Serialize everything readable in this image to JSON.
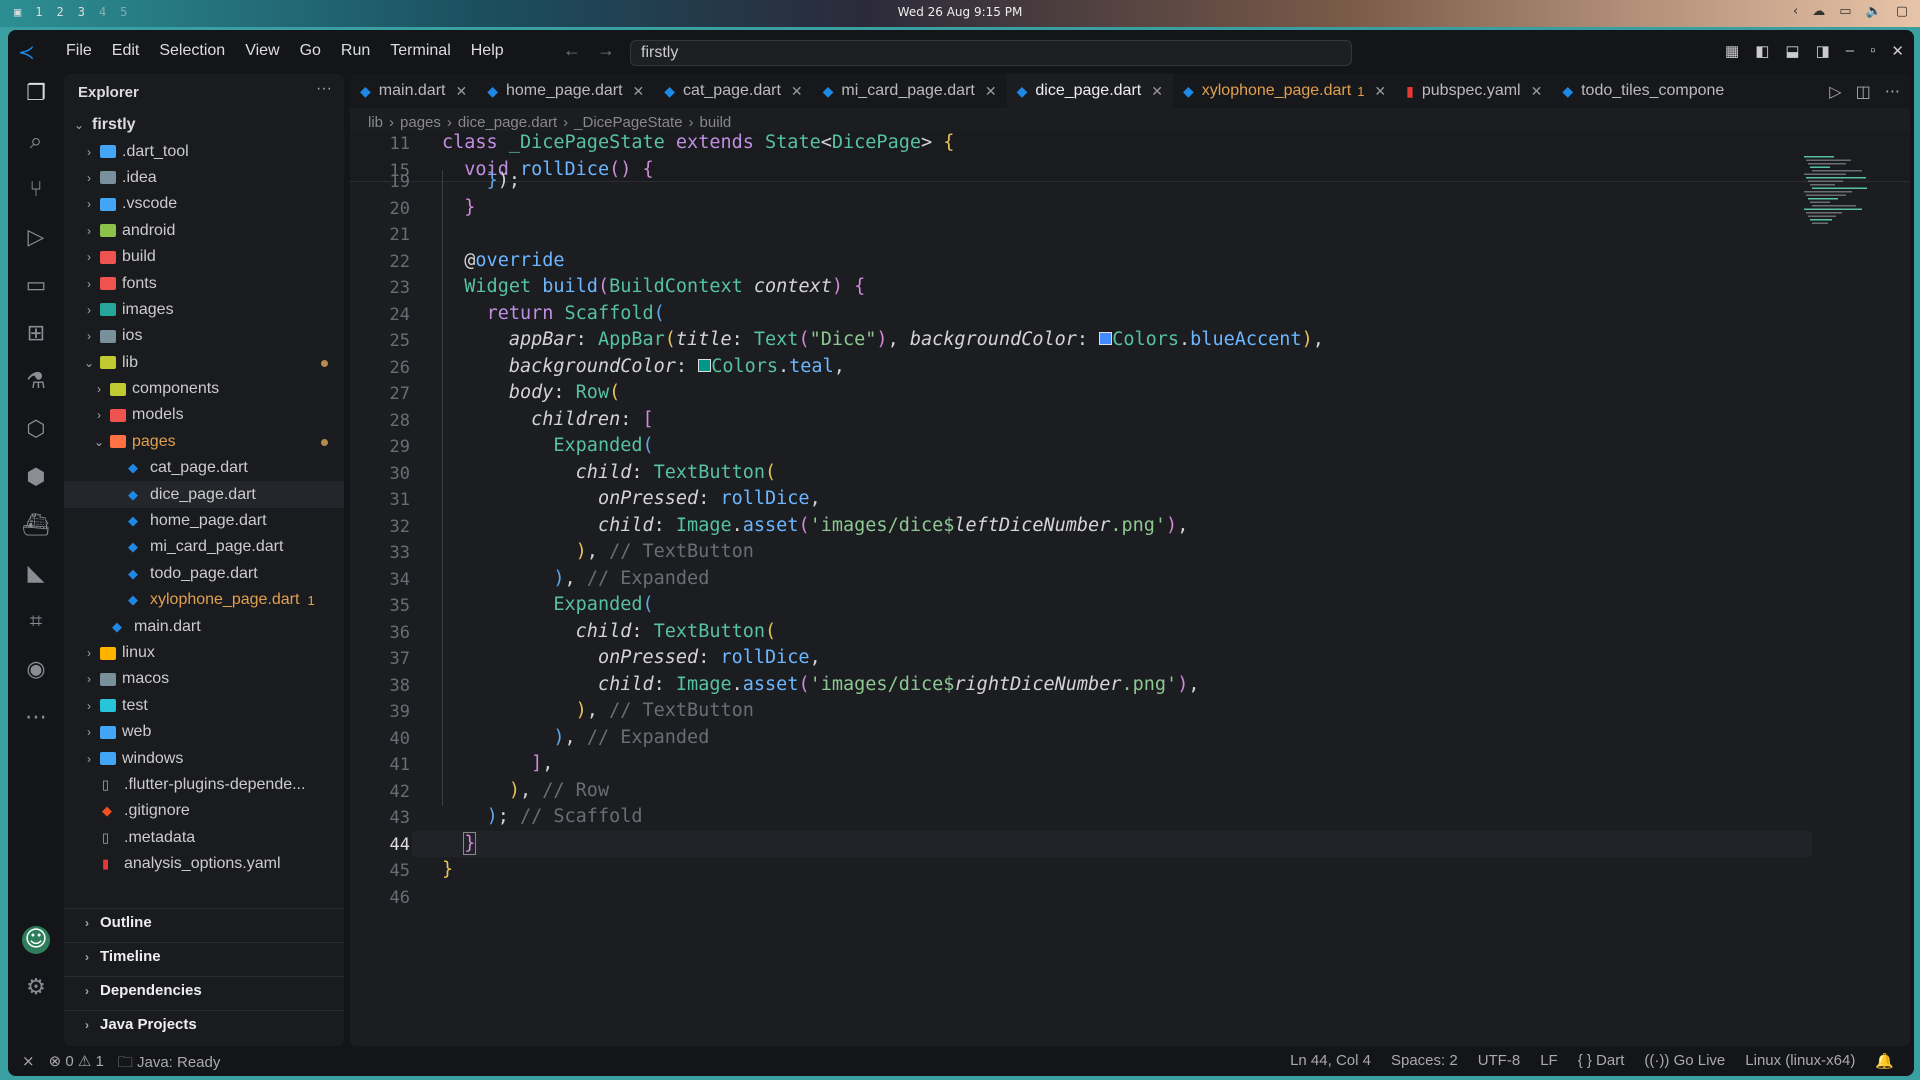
{
  "system_bar": {
    "workspaces": [
      "1",
      "2",
      "3",
      "4",
      "5"
    ],
    "clock": "Wed 26 Aug 9:15 PM"
  },
  "titlebar": {
    "menu": [
      "File",
      "Edit",
      "Selection",
      "View",
      "Go",
      "Run",
      "Terminal",
      "Help"
    ],
    "search_value": "firstly"
  },
  "sidebar": {
    "title": "Explorer",
    "root": "firstly",
    "tree": [
      {
        "label": ".dart_tool",
        "depth": 1,
        "type": "folder",
        "color": "#42a5f5"
      },
      {
        "label": ".idea",
        "depth": 1,
        "type": "folder",
        "color": "#78909c"
      },
      {
        "label": ".vscode",
        "depth": 1,
        "type": "folder",
        "color": "#42a5f5"
      },
      {
        "label": "android",
        "depth": 1,
        "type": "folder",
        "color": "#8bc34a"
      },
      {
        "label": "build",
        "depth": 1,
        "type": "folder",
        "color": "#ef5350"
      },
      {
        "label": "fonts",
        "depth": 1,
        "type": "folder",
        "color": "#ef5350"
      },
      {
        "label": "images",
        "depth": 1,
        "type": "folder",
        "color": "#26a69a"
      },
      {
        "label": "ios",
        "depth": 1,
        "type": "folder",
        "color": "#78909c"
      },
      {
        "label": "lib",
        "depth": 1,
        "type": "folder-open",
        "color": "#c0ca33",
        "modified": true
      },
      {
        "label": "components",
        "depth": 2,
        "type": "folder",
        "color": "#c0ca33"
      },
      {
        "label": "models",
        "depth": 2,
        "type": "folder",
        "color": "#ef5350"
      },
      {
        "label": "pages",
        "depth": 2,
        "type": "folder-open",
        "color": "#ff7043",
        "modified": true,
        "orange": true
      },
      {
        "label": "cat_page.dart",
        "depth": 3,
        "type": "dart"
      },
      {
        "label": "dice_page.dart",
        "depth": 3,
        "type": "dart",
        "selected": true
      },
      {
        "label": "home_page.dart",
        "depth": 3,
        "type": "dart"
      },
      {
        "label": "mi_card_page.dart",
        "depth": 3,
        "type": "dart"
      },
      {
        "label": "todo_page.dart",
        "depth": 3,
        "type": "dart"
      },
      {
        "label": "xylophone_page.dart",
        "depth": 3,
        "type": "dart",
        "orange": true,
        "badge": "1"
      },
      {
        "label": "main.dart",
        "depth": 2,
        "type": "dart"
      },
      {
        "label": "linux",
        "depth": 1,
        "type": "folder",
        "color": "#ffb300"
      },
      {
        "label": "macos",
        "depth": 1,
        "type": "folder",
        "color": "#78909c"
      },
      {
        "label": "test",
        "depth": 1,
        "type": "folder",
        "color": "#26c6da"
      },
      {
        "label": "web",
        "depth": 1,
        "type": "folder",
        "color": "#42a5f5"
      },
      {
        "label": "windows",
        "depth": 1,
        "type": "folder",
        "color": "#42a5f5"
      },
      {
        "label": ".flutter-plugins-depende...",
        "depth": 1,
        "type": "file"
      },
      {
        "label": ".gitignore",
        "depth": 1,
        "type": "git"
      },
      {
        "label": ".metadata",
        "depth": 1,
        "type": "file"
      },
      {
        "label": "analysis_options.yaml",
        "depth": 1,
        "type": "yaml"
      }
    ],
    "sections": [
      "Outline",
      "Timeline",
      "Dependencies",
      "Java Projects"
    ]
  },
  "tabs": [
    {
      "label": "main.dart"
    },
    {
      "label": "home_page.dart"
    },
    {
      "label": "cat_page.dart"
    },
    {
      "label": "mi_card_page.dart"
    },
    {
      "label": "dice_page.dart",
      "active": true
    },
    {
      "label": "xylophone_page.dart",
      "badge": "1",
      "warn": true
    },
    {
      "label": "pubspec.yaml",
      "yaml": true
    },
    {
      "label": "todo_tiles_compone",
      "noclose": true
    }
  ],
  "breadcrumbs": [
    "lib",
    "pages",
    "dice_page.dart",
    "_DicePageState",
    "build"
  ],
  "code": {
    "sticky": [
      {
        "n": "11",
        "html": "<span class='kw'>class</span> <span class='ty'>_DicePageState</span> <span class='kw'>extends</span> <span class='ty'>State</span>&lt;<span class='ty'>DicePage</span>&gt; <span class='br1'>{</span>"
      },
      {
        "n": "15",
        "html": "  <span class='kw'>void</span> <span class='fn'>rollDice</span><span class='br2'>()</span> <span class='br2'>{</span>"
      }
    ],
    "lines": [
      {
        "n": "19",
        "html": "    <span class='br3'>}</span>);"
      },
      {
        "n": "20",
        "html": "  <span class='br2'>}</span>"
      },
      {
        "n": "21",
        "html": ""
      },
      {
        "n": "22",
        "html": "  @<span class='an'>override</span>"
      },
      {
        "n": "23",
        "html": "  <span class='ty'>Widget</span> <span class='fn'>build</span><span class='br2'>(</span><span class='ty'>BuildContext</span> <span class='pr'>context</span><span class='br2'>)</span> <span class='br2'>{</span>"
      },
      {
        "n": "24",
        "html": "    <span class='kw'>return</span> <span class='ty'>Scaffold</span><span class='br3'>(</span>"
      },
      {
        "n": "25",
        "html": "      <span class='pr'>appBar</span>: <span class='ty'>AppBar</span><span class='br1'>(</span><span class='pr'>title</span>: <span class='ty'>Text</span><span class='br2'>(</span><span class='st'>\"Dice\"</span><span class='br2'>)</span>, <span class='pr'>backgroundColor</span>: <span style='display:inline-block;width:13px;height:13px;background:#448aff;border:1px solid #ddd'></span><span class='ty'>Colors</span>.<span class='fn'>blueAccent</span><span class='br1'>)</span>,"
      },
      {
        "n": "26",
        "html": "      <span class='pr'>backgroundColor</span>: <span style='display:inline-block;width:13px;height:13px;background:#009688;border:1px solid #ddd'></span><span class='ty'>Colors</span>.<span class='fn'>teal</span>,"
      },
      {
        "n": "27",
        "html": "      <span class='pr'>body</span>: <span class='ty'>Row</span><span class='br1'>(</span>"
      },
      {
        "n": "28",
        "html": "        <span class='pr'>children</span>: <span class='br2'>[</span>"
      },
      {
        "n": "29",
        "html": "          <span class='ty'>Expanded</span><span class='br3'>(</span>"
      },
      {
        "n": "30",
        "html": "            <span class='pr'>child</span>: <span class='ty'>TextButton</span><span class='br1'>(</span>"
      },
      {
        "n": "31",
        "html": "              <span class='pr'>onPressed</span>: <span class='fn'>rollDice</span>,"
      },
      {
        "n": "32",
        "html": "              <span class='pr'>child</span>: <span class='ty'>Image</span>.<span class='fn'>asset</span><span class='br2'>(</span><span class='st'>'images/dice$</span><span class='pr'>leftDiceNumber</span><span class='st'>.png'</span><span class='br2'>)</span>,"
      },
      {
        "n": "33",
        "html": "            <span class='br1'>)</span>, <span class='cm'>// TextButton</span>"
      },
      {
        "n": "34",
        "html": "          <span class='br3'>)</span>, <span class='cm'>// Expanded</span>"
      },
      {
        "n": "35",
        "html": "          <span class='ty'>Expanded</span><span class='br3'>(</span>"
      },
      {
        "n": "36",
        "html": "            <span class='pr'>child</span>: <span class='ty'>TextButton</span><span class='br1'>(</span>"
      },
      {
        "n": "37",
        "html": "              <span class='pr'>onPressed</span>: <span class='fn'>rollDice</span>,"
      },
      {
        "n": "38",
        "html": "              <span class='pr'>child</span>: <span class='ty'>Image</span>.<span class='fn'>asset</span><span class='br2'>(</span><span class='st'>'images/dice$</span><span class='pr'>rightDiceNumber</span><span class='st'>.png'</span><span class='br2'>)</span>,"
      },
      {
        "n": "39",
        "html": "            <span class='br1'>)</span>, <span class='cm'>// TextButton</span>"
      },
      {
        "n": "40",
        "html": "          <span class='br3'>)</span>, <span class='cm'>// Expanded</span>"
      },
      {
        "n": "41",
        "html": "        <span class='br2'>]</span>,"
      },
      {
        "n": "42",
        "html": "      <span class='br1'>)</span>, <span class='cm'>// Row</span>"
      },
      {
        "n": "43",
        "html": "    <span class='br3'>)</span>; <span class='cm'>// Scaffold</span>"
      },
      {
        "n": "44",
        "html": "  <span class='br2' style='outline:1px solid #888'>}</span>",
        "current": true
      },
      {
        "n": "45",
        "html": "<span class='br1'>}</span>"
      },
      {
        "n": "46",
        "html": ""
      }
    ]
  },
  "status": {
    "errors": "0",
    "warnings": "1",
    "java": "Java: Ready",
    "position": "Ln 44, Col 4",
    "spaces": "Spaces: 2",
    "encoding": "UTF-8",
    "eol": "LF",
    "language": "{ } Dart",
    "golive": "Go Live",
    "platform": "Linux (linux-x64)"
  }
}
